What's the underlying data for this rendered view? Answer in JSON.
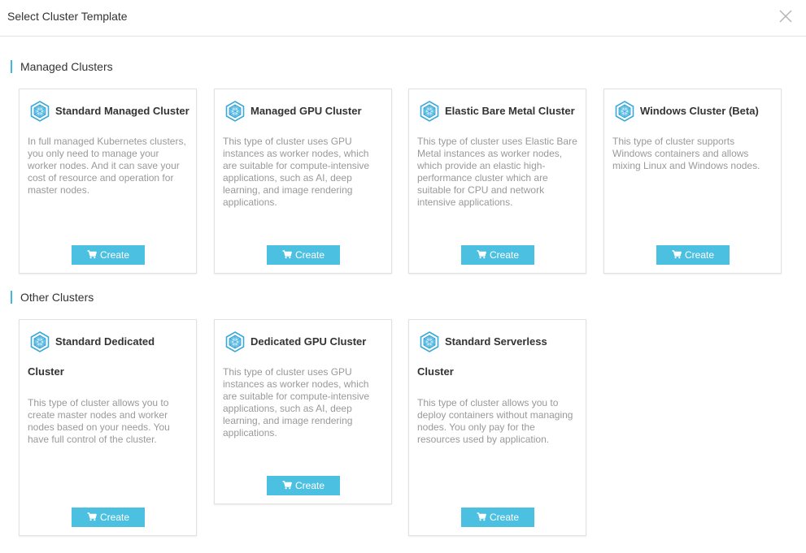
{
  "dialog": {
    "title": "Select Cluster Template",
    "close_icon": "close-icon"
  },
  "sections": {
    "managed": {
      "title": "Managed Clusters"
    },
    "other": {
      "title": "Other Clusters"
    }
  },
  "cards": {
    "standard_managed": {
      "title": "Standard Managed Cluster",
      "description": "In full managed Kubernetes clusters, you only need to manage your worker nodes. And it can save your cost of resource and operation for master nodes.",
      "button": "Create"
    },
    "managed_gpu": {
      "title": "Managed GPU Cluster",
      "description": "This type of cluster uses GPU instances as worker nodes, which are suitable for compute-intensive applications, such as AI, deep learning, and image rendering applications.",
      "button": "Create"
    },
    "elastic_bare_metal": {
      "title": "Elastic Bare Metal Cluster",
      "description": "This type of cluster uses Elastic Bare Metal instances as worker nodes, which provide an elastic high-performance cluster which are suitable for CPU and network intensive applications.",
      "button": "Create"
    },
    "windows": {
      "title": "Windows Cluster (Beta)",
      "description": "This type of cluster supports Windows containers and allows mixing Linux and Windows nodes.",
      "button": "Create"
    },
    "standard_dedicated": {
      "title_line1": "Standard Dedicated",
      "title_line2": "Cluster",
      "description": "This type of cluster allows you to create master nodes and worker nodes based on your needs. You have full control of the cluster.",
      "button": "Create"
    },
    "dedicated_gpu": {
      "title": "Dedicated GPU Cluster",
      "description": "This type of cluster uses GPU instances as worker nodes, which are suitable for compute-intensive applications, such as AI, deep learning, and image rendering applications.",
      "button": "Create"
    },
    "standard_serverless": {
      "title_line1": "Standard Serverless",
      "title_line2": "Cluster",
      "description": "This type of cluster allows you to deploy containers without managing nodes. You only pay for the resources used by application.",
      "button": "Create"
    }
  },
  "icons": {
    "cluster": "cluster-hexagon-icon",
    "cart": "cart-icon"
  },
  "colors": {
    "accent": "#4cc0e0",
    "section_bar": "#45b6e0",
    "description_text": "#999999",
    "title_text": "#333333"
  }
}
